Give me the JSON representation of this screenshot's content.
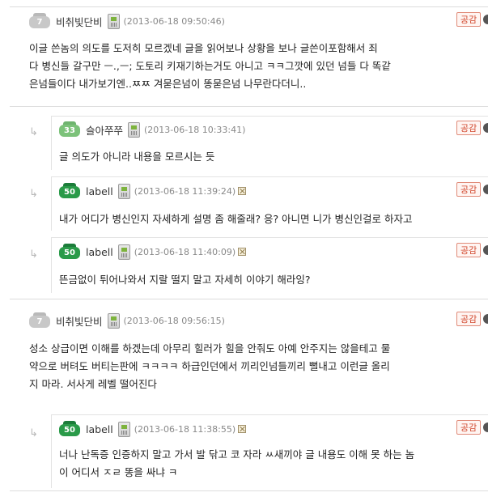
{
  "like_label": "공감",
  "comments": [
    {
      "id": "c1",
      "nick": "비취빛단비",
      "level": "7",
      "date": "(2013-06-18 09:50:46)",
      "lines": [
        "이글 쓴놈의 의도를 도저히 모르겠네 글을 읽어보나 상황을 보나 글쓴이포함해서 죄",
        "다 병신들 갈구만 ㅡ.,ㅡ; 도토리 키재기하는거도 아니고 ㅋㅋ그깟에 있던 넘들 다 똑같",
        "은넘들이다 내가보기엔..ㅉㅉ 겨묻은넘이 똥묻은넘 나무란다더니.."
      ]
    },
    {
      "id": "r1",
      "nick": "슬아쭈쭈",
      "level": "33",
      "date": "(2013-06-18 10:33:41)",
      "lines": [
        "글 의도가 아니라 내용을 모르시는 듯"
      ]
    },
    {
      "id": "r2",
      "nick": "labell",
      "level": "50",
      "date": "(2013-06-18 11:39:24)",
      "lines": [
        "내가 어디가 병신인지 자세하게 설명 좀 해줄래? 응? 아니면 니가 병신인걸로 하자고"
      ]
    },
    {
      "id": "r3",
      "nick": "labell",
      "level": "50",
      "date": "(2013-06-18 11:40:09)",
      "lines": [
        "뜬금없이 튀어나와서 지랄 떨지 말고 자세히 이야기 해라잉?"
      ]
    },
    {
      "id": "c2",
      "nick": "비취빛단비",
      "level": "7",
      "date": "(2013-06-18 09:56:15)",
      "lines": [
        "성소 상급이면 이해를 하겠는데 아무리 힐러가 힐을 안줘도 아예 안주지는 않을테고 물",
        "약으로 버텨도 버티는판에 ㅋㅋㅋㅋ 하급인던에서 끼리인넘들끼리 뻘내고 이런글 올리",
        "지 마라. 서사게 레벨 떨어진다"
      ]
    },
    {
      "id": "r4",
      "nick": "labell",
      "level": "50",
      "date": "(2013-06-18 11:38:55)",
      "lines": [
        "너나 난독증 인증하지 말고 가서 발 닦고 코 자라 ㅆ새끼야 글 내용도 이해 못 하는 놈",
        "이 어디서 ㅈㄹ 똥을 싸냐 ㅋ"
      ]
    }
  ]
}
